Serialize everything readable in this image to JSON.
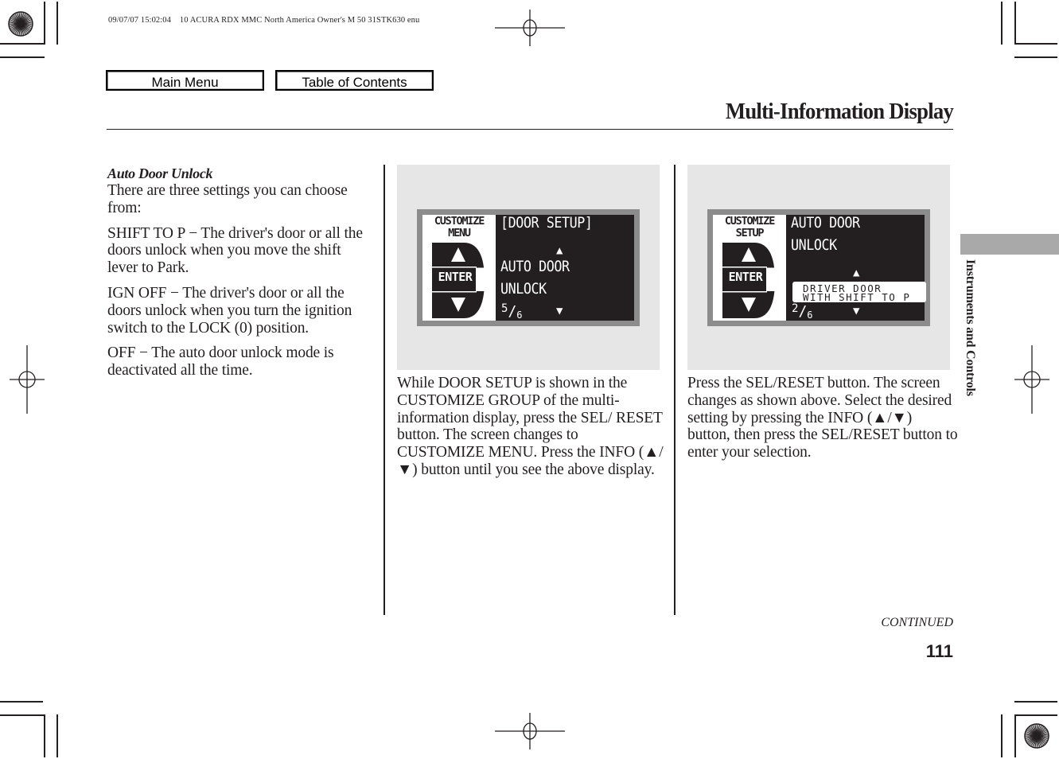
{
  "print_slug": "09/07/07 15:02:04    10 ACURA RDX MMC North America Owner's M 50 31STK630 enu",
  "nav": {
    "main_menu": "Main Menu",
    "table_of_contents": "Table of Contents"
  },
  "page_title": "Multi-Information Display",
  "column1": {
    "heading": "Auto Door Unlock",
    "intro": "There are three settings you can choose from:",
    "settings": [
      {
        "text": "SHIFT TO P − The driver's door or all the doors unlock when you move the shift lever to Park."
      },
      {
        "text": "IGN OFF − The driver's door or all the doors unlock when you turn the ignition switch to the LOCK (0) position."
      },
      {
        "text": "OFF − The auto door unlock mode is deactivated all the time."
      }
    ]
  },
  "display1": {
    "left_header_line1": "CUSTOMIZE",
    "left_header_line2": "MENU",
    "enter_label": "ENTER",
    "line1": "[DOOR SETUP]",
    "line2": "AUTO DOOR",
    "line3": "UNLOCK",
    "page_num": "5",
    "page_den": "6"
  },
  "display2": {
    "left_header_line1": "CUSTOMIZE",
    "left_header_line2": "SETUP",
    "enter_label": "ENTER",
    "line1": "AUTO DOOR",
    "line2": "UNLOCK",
    "selected_line1": "DRIVER DOOR",
    "selected_line2": "WITH SHIFT TO P",
    "page_num": "2",
    "page_den": "6"
  },
  "column2": {
    "text": "While DOOR SETUP is shown in the CUSTOMIZE GROUP of the multi-information display, press the SEL/ RESET button. The screen changes to CUSTOMIZE MENU. Press the INFO (▲/▼) button until you see the above display."
  },
  "column3": {
    "text": "Press the SEL/RESET button. The screen changes as shown above. Select the desired setting by pressing the INFO (▲/▼) button, then press the SEL/RESET button to enter your selection."
  },
  "side_tab": "Instruments and Controls",
  "continued": "CONTINUED",
  "page_number": "111",
  "icons": {
    "arrow_up": "▲",
    "arrow_down": "▼"
  }
}
